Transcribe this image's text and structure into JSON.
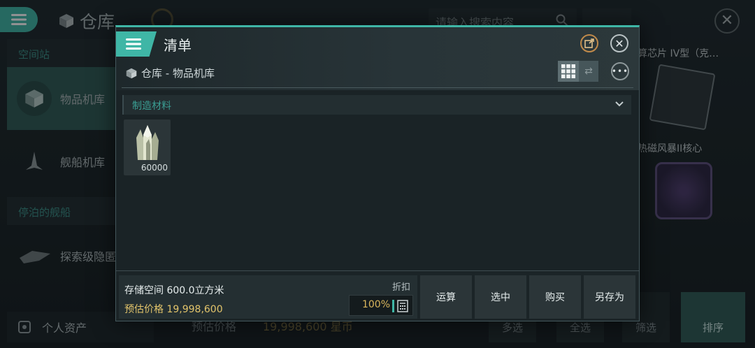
{
  "background": {
    "app_title": "仓库",
    "search_placeholder": "请输入搜索内容",
    "sidebar": {
      "section_station": "空间站",
      "item_warehouse": "物品机库",
      "item_ship_hangar": "舰船机库",
      "section_docked": "停泊的舰船",
      "docked_ship": "探索级隐匿",
      "personal_assets": "个人资产"
    },
    "cards": {
      "chip_title": "算芯片 IV型（克…",
      "core_title": "热磁风暴II核心"
    },
    "bottom": {
      "price_label": "预估价格",
      "price_value": "19,998,600 星币",
      "multi_select": "多选",
      "select_all": "全选",
      "filter": "筛选",
      "sort": "排序"
    }
  },
  "modal": {
    "title": "清单",
    "breadcrumb": "仓库 - 物品机库",
    "category": "制造材料",
    "items": [
      {
        "name": "crystal-material",
        "quantity": "60000"
      }
    ],
    "footer": {
      "storage": "存储空间 600.0立方米",
      "price_label": "预估价格",
      "price_value": "19,998,600",
      "discount_label": "折扣",
      "discount_value": "100%",
      "buttons": {
        "calculate": "运算",
        "select": "选中",
        "buy": "购买",
        "save_as": "另存为"
      }
    }
  },
  "colors": {
    "accent": "#3fb6a6",
    "price": "#e2c46b"
  }
}
